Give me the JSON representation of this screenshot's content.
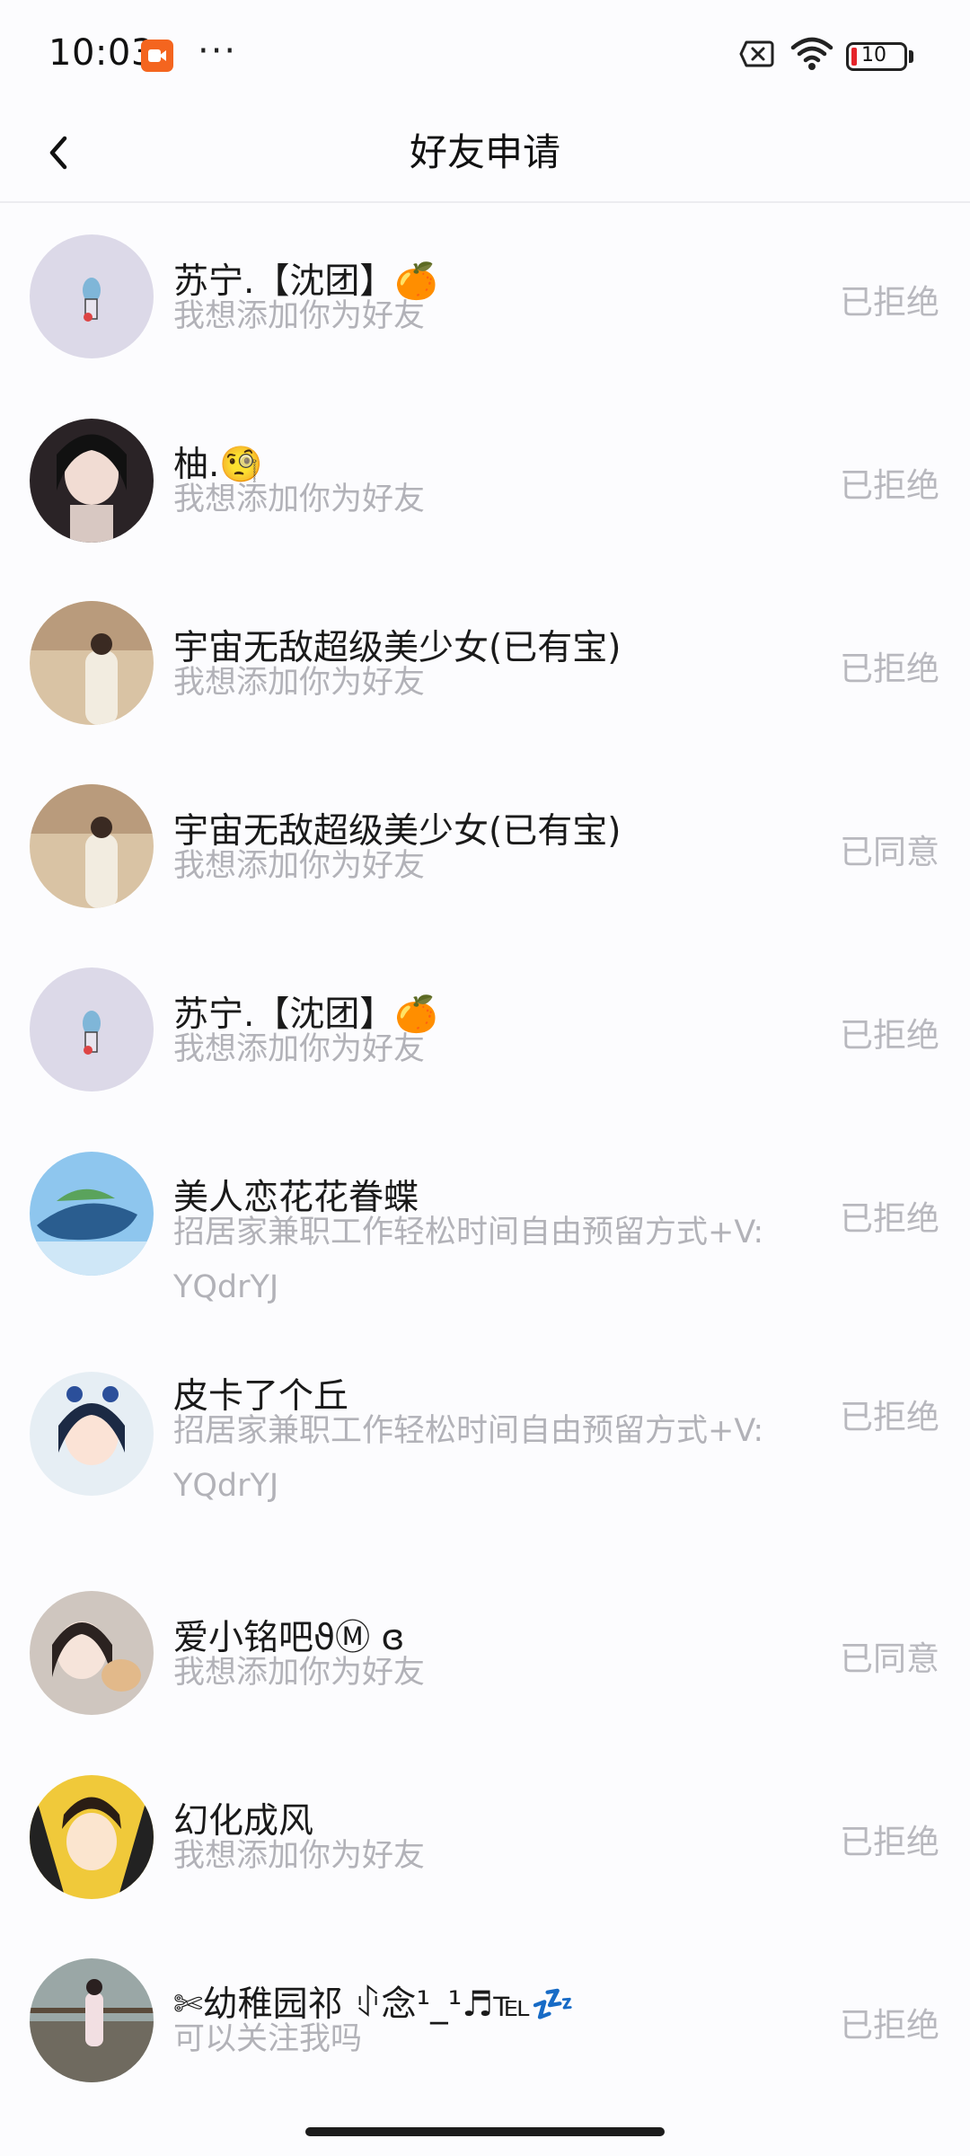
{
  "status_bar": {
    "time": "10:03",
    "more": "···",
    "battery_level": "10",
    "icons": [
      "screen-record-icon",
      "no-sim-icon",
      "wifi-icon",
      "battery-icon"
    ]
  },
  "nav": {
    "title": "好友申请",
    "back_icon": "chevron-left-icon"
  },
  "colors": {
    "status_text": "#b8b8be",
    "battery_low": "#e5242b",
    "record_badge": "#f4651f"
  },
  "requests": [
    {
      "name": "苏宁.【沈团】🍊",
      "message": "我想添加你为好友",
      "status": "已拒绝"
    },
    {
      "name": "柚.🧐",
      "message": "我想添加你为好友",
      "status": "已拒绝"
    },
    {
      "name": "宇宙无敌超级美少女(已有宝)",
      "message": "我想添加你为好友",
      "status": "已拒绝"
    },
    {
      "name": "宇宙无敌超级美少女(已有宝)",
      "message": "我想添加你为好友",
      "status": "已同意"
    },
    {
      "name": "苏宁.【沈团】🍊",
      "message": "我想添加你为好友",
      "status": "已拒绝"
    },
    {
      "name": "美人恋花花眷蝶",
      "message": "招居家兼职工作轻松时间自由预留方式+V: YQdrYJ",
      "status": "已拒绝"
    },
    {
      "name": "皮卡了个丘",
      "message": "招居家兼职工作轻松时间自由预留方式+V: YQdrYJ",
      "status": "已拒绝"
    },
    {
      "name": "爱小铭吧ϑⓂ ɞ",
      "message": "我想添加你为好友",
      "status": "已同意"
    },
    {
      "name": "幻化成风",
      "message": "我想添加你为好友",
      "status": "已拒绝"
    },
    {
      "name": "✄幼稚园祁 ꂑ念¹_¹♬℡💤",
      "message": "可以关注我吗",
      "status": "已拒绝"
    }
  ]
}
